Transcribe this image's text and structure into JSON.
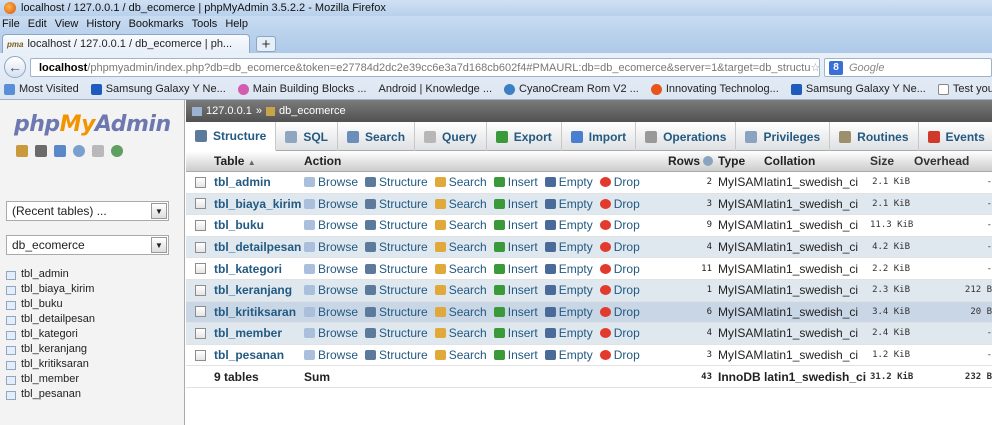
{
  "window": {
    "title": "localhost / 127.0.0.1 / db_ecomerce | phpMyAdmin 3.5.2.2 - Mozilla Firefox"
  },
  "menu": [
    "File",
    "Edit",
    "View",
    "History",
    "Bookmarks",
    "Tools",
    "Help"
  ],
  "browser_tab": {
    "label": "localhost / 127.0.0.1 / db_ecomerce | ph...",
    "icon_text": "pma",
    "new_tab": "+"
  },
  "url": {
    "host": "localhost",
    "rest": "/phpmyadmin/index.php?db=db_ecomerce&token=e27784d2dc2e39cc6e3a7d168cb602f4#PMAURL:db=db_ecomerce&server=1&target=db_structu",
    "controls": "☆ ▽ C",
    "search_placeholder": "Google",
    "search_engine": "8"
  },
  "bookmarks": [
    "Most Visited",
    "Samsung Galaxy Y Ne...",
    "Main Building Blocks ...",
    "Android | Knowledge ...",
    "CyanoCream Rom V2 ...",
    "Innovating Technolog...",
    "Samsung Galaxy Y Ne...",
    "Test your Pr"
  ],
  "nav": {
    "logo": {
      "php": "php",
      "my": "My",
      "admin": "Admin"
    },
    "recent_select": "(Recent tables) ...",
    "db_select": "db_ecomerce",
    "tables": [
      "tbl_admin",
      "tbl_biaya_kirim",
      "tbl_buku",
      "tbl_detailpesan",
      "tbl_kategori",
      "tbl_keranjang",
      "tbl_kritiksaran",
      "tbl_member",
      "tbl_pesanan"
    ]
  },
  "breadcrumb": {
    "server": "127.0.0.1",
    "sep": "»",
    "db": "db_ecomerce"
  },
  "tabs": [
    {
      "label": "Structure",
      "color": "#5c7a9c"
    },
    {
      "label": "SQL",
      "color": "#8fa6c1"
    },
    {
      "label": "Search",
      "color": "#6b8fb8"
    },
    {
      "label": "Query",
      "color": "#b7b7b7"
    },
    {
      "label": "Export",
      "color": "#3a9a3a"
    },
    {
      "label": "Import",
      "color": "#4a7fcf"
    },
    {
      "label": "Operations",
      "color": "#999999"
    },
    {
      "label": "Privileges",
      "color": "#8aa3c0"
    },
    {
      "label": "Routines",
      "color": "#9c8f6e"
    },
    {
      "label": "Events",
      "color": "#d03a2a"
    }
  ],
  "table_headers": {
    "table": "Table",
    "sort": "▲",
    "action": "Action",
    "rows": "Rows",
    "type": "Type",
    "collation": "Collation",
    "size": "Size",
    "overhead": "Overhead"
  },
  "actions": [
    "Browse",
    "Structure",
    "Search",
    "Insert",
    "Empty",
    "Drop"
  ],
  "rows": [
    {
      "name": "tbl_admin",
      "rows": "2",
      "type": "MyISAM",
      "collation": "latin1_swedish_ci",
      "size": "2.1 KiB",
      "overhead": "-"
    },
    {
      "name": "tbl_biaya_kirim",
      "rows": "3",
      "type": "MyISAM",
      "collation": "latin1_swedish_ci",
      "size": "2.1 KiB",
      "overhead": "-"
    },
    {
      "name": "tbl_buku",
      "rows": "9",
      "type": "MyISAM",
      "collation": "latin1_swedish_ci",
      "size": "11.3 KiB",
      "overhead": "-"
    },
    {
      "name": "tbl_detailpesan",
      "rows": "4",
      "type": "MyISAM",
      "collation": "latin1_swedish_ci",
      "size": "4.2 KiB",
      "overhead": "-"
    },
    {
      "name": "tbl_kategori",
      "rows": "11",
      "type": "MyISAM",
      "collation": "latin1_swedish_ci",
      "size": "2.2 KiB",
      "overhead": "-"
    },
    {
      "name": "tbl_keranjang",
      "rows": "1",
      "type": "MyISAM",
      "collation": "latin1_swedish_ci",
      "size": "2.3 KiB",
      "overhead": "212 B"
    },
    {
      "name": "tbl_kritiksaran",
      "rows": "6",
      "type": "MyISAM",
      "collation": "latin1_swedish_ci",
      "size": "3.4 KiB",
      "overhead": "20 B"
    },
    {
      "name": "tbl_member",
      "rows": "4",
      "type": "MyISAM",
      "collation": "latin1_swedish_ci",
      "size": "2.4 KiB",
      "overhead": "-"
    },
    {
      "name": "tbl_pesanan",
      "rows": "3",
      "type": "MyISAM",
      "collation": "latin1_swedish_ci",
      "size": "1.2 KiB",
      "overhead": "-"
    }
  ],
  "footer": {
    "count": "9 tables",
    "sum": "Sum",
    "rows": "43",
    "type": "InnoDB",
    "collation": "latin1_swedish_ci",
    "size": "31.2 KiB",
    "overhead": "232 B"
  }
}
